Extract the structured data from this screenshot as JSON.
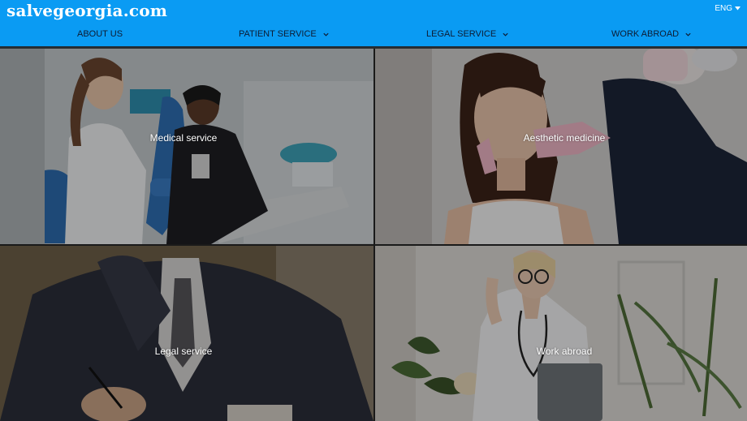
{
  "brand": {
    "logo_text": "salvegeorgia.com"
  },
  "language": {
    "current": "ENG"
  },
  "nav": {
    "items": [
      {
        "label": "ABOUT US",
        "has_dropdown": false
      },
      {
        "label": "PATIENT SERVICE",
        "has_dropdown": true
      },
      {
        "label": "LEGAL SERVICE",
        "has_dropdown": true
      },
      {
        "label": "WORK ABROAD",
        "has_dropdown": true
      }
    ]
  },
  "tiles": [
    {
      "label": "Medical service"
    },
    {
      "label": "Aesthetic medicine"
    },
    {
      "label": "Legal service"
    },
    {
      "label": "Work abroad"
    }
  ],
  "colors": {
    "header_bg": "#0a9bf3",
    "nav_text": "#0d1c33",
    "logo_text": "#ffffff"
  },
  "icons": {
    "dropdown": "chevron-down-icon",
    "language_dropdown": "caret-down-icon"
  }
}
